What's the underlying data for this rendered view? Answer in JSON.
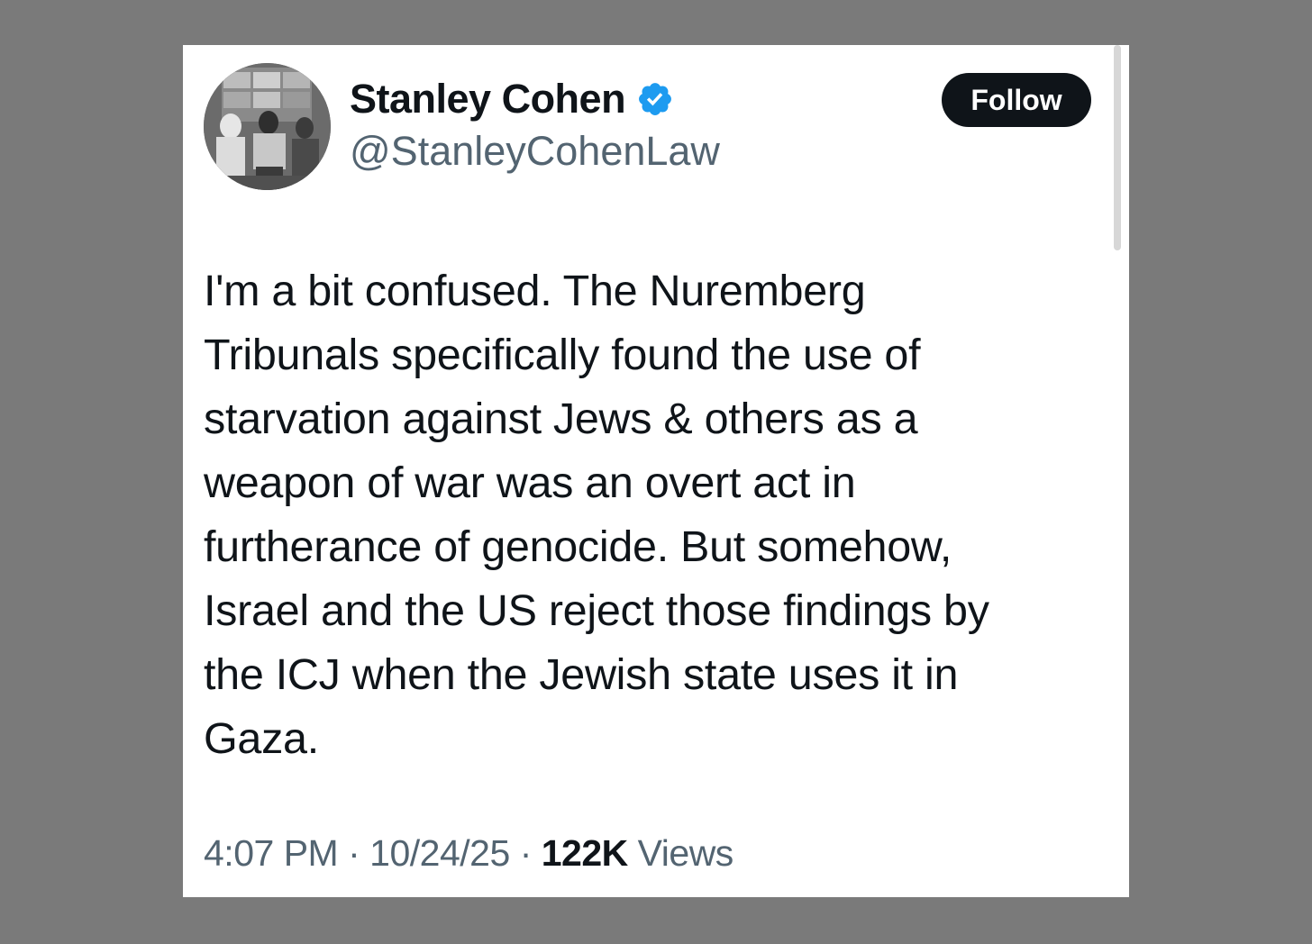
{
  "tweet": {
    "author": {
      "display_name": "Stanley Cohen",
      "handle": "@StanleyCohenLaw",
      "verified_icon": "verified-badge-icon",
      "avatar_icon": "avatar-photo"
    },
    "follow_label": "Follow",
    "text": "I'm a bit confused. The Nuremberg\nTribunals specifically found the use of\nstarvation against Jews & others as a\nweapon of war was an overt act  in\nfurtherance of genocide. But somehow,\nIsrael and the US  reject those findings by\nthe ICJ when the Jewish state uses it in\nGaza.",
    "time": "4:07 PM",
    "separator": "·",
    "date": "10/24/25",
    "views_count": "122K",
    "views_label": "Views"
  },
  "colors": {
    "background": "#7a7a7a",
    "card": "#ffffff",
    "text_primary": "#0f1419",
    "text_secondary": "#536471",
    "verified_blue": "#1d9bf0",
    "follow_bg": "#0f1419"
  }
}
